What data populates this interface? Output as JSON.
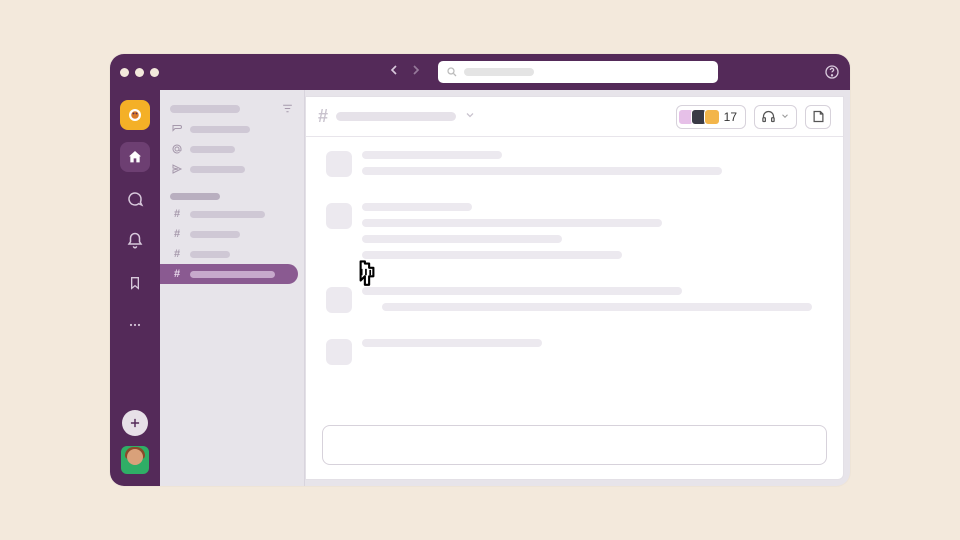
{
  "header": {
    "member_count": "17"
  },
  "icons": {
    "workspace": "workspace",
    "home": "home",
    "dm": "dm",
    "activity": "activity",
    "later": "later",
    "more": "more"
  }
}
